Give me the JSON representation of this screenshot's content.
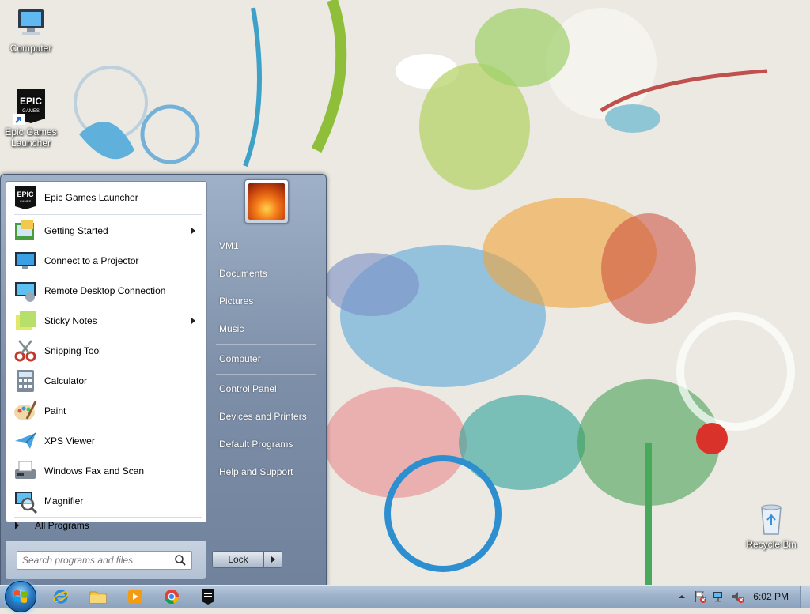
{
  "desktop": {
    "icons": [
      {
        "label": "Computer",
        "icon": "computer-icon"
      },
      {
        "label": "Epic Games Launcher",
        "icon": "epic-games-icon"
      },
      {
        "label": "Recycle Bin",
        "icon": "recycle-bin-icon"
      }
    ]
  },
  "start_menu": {
    "pinned": {
      "label": "Epic Games Launcher",
      "icon": "epic-games-icon"
    },
    "recent": [
      {
        "label": "Getting Started",
        "icon": "getting-started-icon",
        "has_submenu": true
      },
      {
        "label": "Connect to a Projector",
        "icon": "projector-icon",
        "has_submenu": false
      },
      {
        "label": "Remote Desktop Connection",
        "icon": "remote-desktop-icon",
        "has_submenu": false
      },
      {
        "label": "Sticky Notes",
        "icon": "sticky-notes-icon",
        "has_submenu": true
      },
      {
        "label": "Snipping Tool",
        "icon": "snipping-tool-icon",
        "has_submenu": false
      },
      {
        "label": "Calculator",
        "icon": "calculator-icon",
        "has_submenu": false
      },
      {
        "label": "Paint",
        "icon": "paint-icon",
        "has_submenu": false
      },
      {
        "label": "XPS Viewer",
        "icon": "xps-viewer-icon",
        "has_submenu": false
      },
      {
        "label": "Windows Fax and Scan",
        "icon": "fax-scan-icon",
        "has_submenu": false
      },
      {
        "label": "Magnifier",
        "icon": "magnifier-icon",
        "has_submenu": false
      }
    ],
    "all_programs_label": "All Programs",
    "search_placeholder": "Search programs and files",
    "right_items": [
      {
        "label": "VM1"
      },
      {
        "label": "Documents"
      },
      {
        "label": "Pictures"
      },
      {
        "label": "Music"
      },
      {
        "label": "Computer"
      },
      {
        "label": "Control Panel"
      },
      {
        "label": "Devices and Printers"
      },
      {
        "label": "Default Programs"
      },
      {
        "label": "Help and Support"
      }
    ],
    "shutdown_label": "Lock"
  },
  "taskbar": {
    "pinned": [
      {
        "icon": "internet-explorer-icon"
      },
      {
        "icon": "file-explorer-icon"
      },
      {
        "icon": "media-player-icon"
      },
      {
        "icon": "chrome-icon"
      },
      {
        "icon": "epic-games-icon"
      }
    ],
    "clock": "6:02 PM"
  },
  "colors": {
    "accent": "#2c7cc4",
    "menu_bg": "#8799b1"
  }
}
